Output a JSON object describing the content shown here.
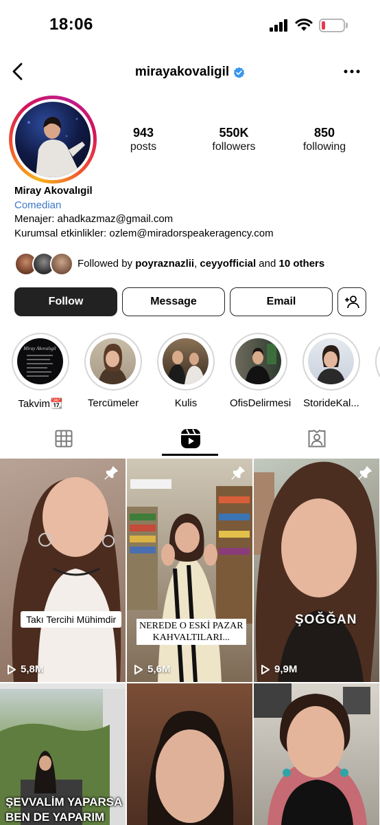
{
  "status_bar": {
    "time": "18:06"
  },
  "nav": {
    "username": "mirayakovaligil"
  },
  "profile": {
    "stats": [
      {
        "value": "943",
        "label": "posts"
      },
      {
        "value": "550K",
        "label": "followers"
      },
      {
        "value": "850",
        "label": "following"
      }
    ],
    "name": "Miray Akovalıgil",
    "category": "Comedian",
    "bio_lines": [
      "Menajer: ahadkazmaz@gmail.com",
      "Kurumsal etkinlikler: ozlem@miradorspeakeragency.com"
    ],
    "followed_by": {
      "prefix": "Followed by ",
      "user1": "poyraznazlii",
      "sep": ", ",
      "user2": "ceyyofficial",
      "middle": " and ",
      "others": "10 others"
    }
  },
  "actions": {
    "follow": "Follow",
    "message": "Message",
    "email": "Email"
  },
  "highlights": [
    {
      "label": "Takvim📆"
    },
    {
      "label": "Tercümeler"
    },
    {
      "label": "Kulis"
    },
    {
      "label": "OfisDelirmesi"
    },
    {
      "label": "StorideKal..."
    }
  ],
  "reels": [
    {
      "caption": "Takı Tercihi Mühimdir",
      "views": "5,8M"
    },
    {
      "caption_line1": "NEREDE O ESKİ PAZAR",
      "caption_line2": "KAHVALTILARI...",
      "views": "5,6M"
    },
    {
      "caption": "ŞOĞĞAN",
      "views": "9,9M"
    },
    {
      "caption_line1": "ŞEVVALİM YAPARSA",
      "caption_line2": "BEN DE YAPARIM"
    },
    {},
    {}
  ],
  "colors": {
    "accent_blue": "#3d78c8",
    "verified_blue": "#3897f0",
    "follow_bg": "#222222",
    "battery_low": "#e8384f"
  }
}
